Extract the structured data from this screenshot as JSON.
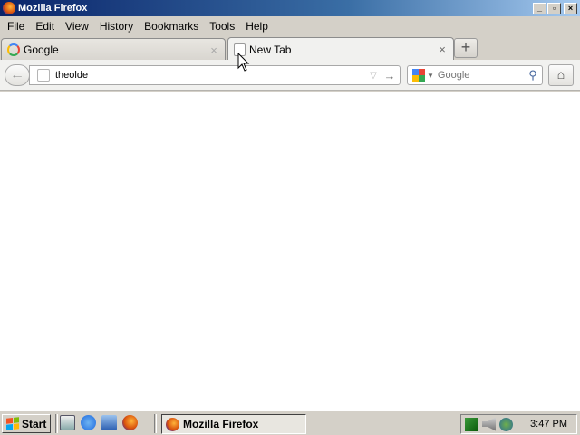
{
  "window": {
    "title": "Mozilla Firefox"
  },
  "menubar": {
    "items": [
      {
        "label": "File",
        "accel": "F"
      },
      {
        "label": "Edit",
        "accel": "E"
      },
      {
        "label": "View",
        "accel": "V"
      },
      {
        "label": "History",
        "accel": "s"
      },
      {
        "label": "Bookmarks",
        "accel": "B"
      },
      {
        "label": "Tools",
        "accel": "T"
      },
      {
        "label": "Help",
        "accel": "H"
      }
    ]
  },
  "tabs": [
    {
      "label": "Google",
      "close": "×",
      "icon": "google-favicon"
    },
    {
      "label": "New Tab",
      "close": "×",
      "icon": "blank-page-icon"
    }
  ],
  "newtab": {
    "label": "+"
  },
  "navbar": {
    "back": "←",
    "url_value": "theolde",
    "go": "→",
    "search_placeholder": "Google",
    "home": "⌂"
  },
  "taskbar": {
    "start_label": "Start",
    "task_label": "Mozilla Firefox",
    "clock": "3:47 PM"
  },
  "colors": {
    "titlebar_start": "#0a246a",
    "titlebar_end": "#a6caf0",
    "chrome": "#d4d0c8"
  }
}
